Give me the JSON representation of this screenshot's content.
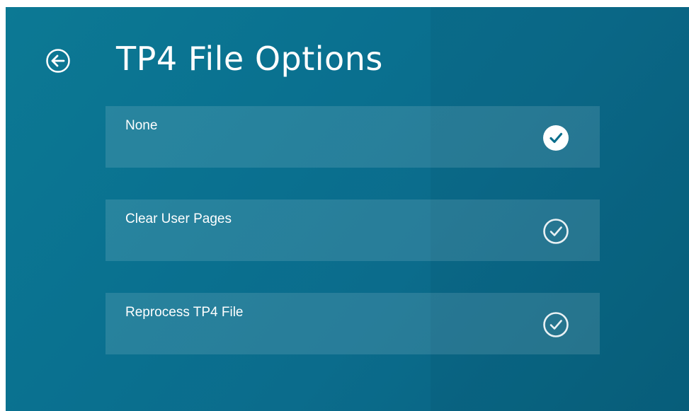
{
  "header": {
    "title": "TP4 File Options",
    "back_icon": "back-arrow-circle-icon"
  },
  "options": [
    {
      "label": "None",
      "selected": true,
      "icon": "check-circle-filled-icon"
    },
    {
      "label": "Clear User Pages",
      "selected": false,
      "icon": "check-circle-outline-icon"
    },
    {
      "label": "Reprocess TP4 File",
      "selected": false,
      "icon": "check-circle-outline-icon"
    }
  ],
  "colors": {
    "background": "#0a7190",
    "text": "#ffffff",
    "selected_check": "#0b6e8c"
  }
}
